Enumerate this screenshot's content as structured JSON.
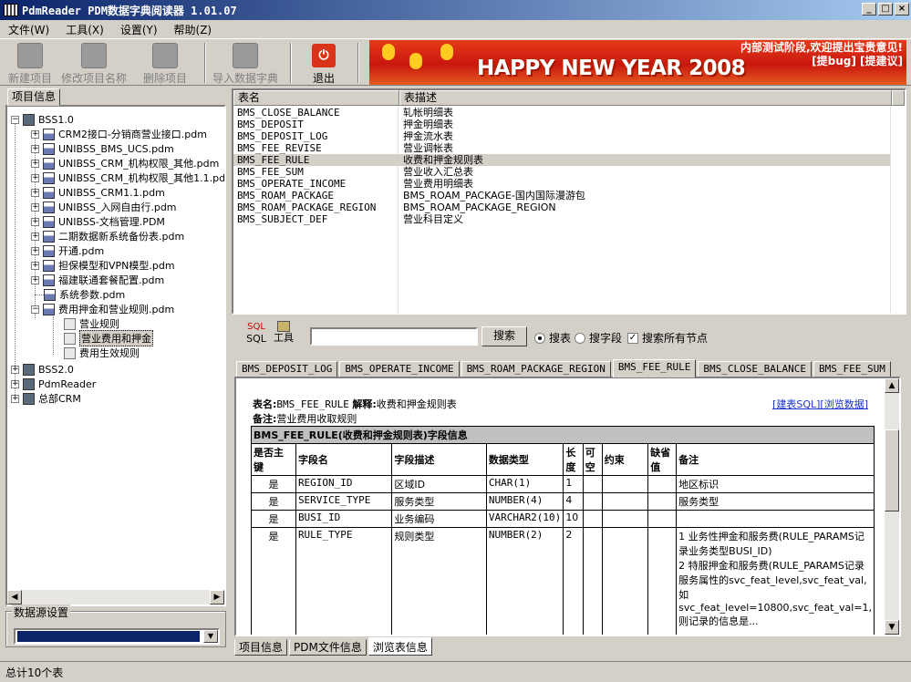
{
  "window": {
    "title": "PdmReader PDM数据字典阅读器 1.01.07",
    "controls": [
      "_",
      "□",
      "×"
    ]
  },
  "menu": [
    "文件(W)",
    "工具(X)",
    "设置(Y)",
    "帮助(Z)"
  ],
  "toolbar": {
    "new_project": "新建项目",
    "rename_project": "修改项目名称",
    "delete_project": "删除项目",
    "import_pdm": "导入数据字典",
    "exit": "退出"
  },
  "banner": {
    "headline": "HAPPY NEW YEAR 2008",
    "notice_line1": "内部测试阶段,欢迎提出宝贵意见!",
    "notice_line2": "[提bug] [提建议]"
  },
  "left_panel": {
    "tab": "项目信息",
    "tree": {
      "roots": [
        "BSS1.0",
        "BSS2.0",
        "PdmReader",
        "总部CRM"
      ],
      "bss1_children": [
        "CRM2接口-分销商营业接口.pdm",
        "UNIBSS_BMS_UCS.pdm",
        "UNIBSS_CRM_机构权限_其他.pdm",
        "UNIBSS_CRM_机构权限_其他1.1.pdm",
        "UNIBSS_CRM1.1.pdm",
        "UNIBSS_入网自由行.pdm",
        "UNIBSS-文档管理.PDM",
        "二期数据新系统备份表.pdm",
        "开通.pdm",
        "担保模型和VPN模型.pdm",
        "福建联通套餐配置.pdm",
        "系统参数.pdm",
        "费用押金和营业规则.pdm"
      ],
      "fee_children": [
        "营业规则",
        "营业费用和押金",
        "费用生效规则"
      ]
    },
    "datasource_label": "数据源设置"
  },
  "table_list": {
    "columns": [
      "表名",
      "表描述"
    ],
    "rows": [
      [
        "BMS_CLOSE_BALANCE",
        "轧帐明细表"
      ],
      [
        "BMS_DEPOSIT",
        "押金明细表"
      ],
      [
        "BMS_DEPOSIT_LOG",
        "押金流水表"
      ],
      [
        "BMS_FEE_REVISE",
        "营业调帐表"
      ],
      [
        "BMS_FEE_RULE",
        "收费和押金规则表"
      ],
      [
        "BMS_FEE_SUM",
        "营业收入汇总表"
      ],
      [
        "BMS_OPERATE_INCOME",
        "营业费用明细表"
      ],
      [
        "BMS_ROAM_PACKAGE",
        "BMS_ROAM_PACKAGE-国内国际漫游包"
      ],
      [
        "BMS_ROAM_PACKAGE_REGION",
        "BMS_ROAM_PACKAGE_REGION"
      ],
      [
        "BMS_SUBJECT_DEF",
        "营业科目定义"
      ]
    ]
  },
  "search": {
    "sql_label": "SQL",
    "tools_label": "工具",
    "sql_icon_text": "SQL",
    "input_value": "",
    "button": "搜索",
    "radio_table": "搜表",
    "radio_field": "搜字段",
    "checkbox_all": "搜索所有节点"
  },
  "detail_tabs": [
    "BMS_DEPOSIT_LOG",
    "BMS_OPERATE_INCOME",
    "BMS_ROAM_PACKAGE_REGION",
    "BMS_FEE_RULE",
    "BMS_CLOSE_BALANCE",
    "BMS_FEE_SUM"
  ],
  "detail": {
    "table_label": "表名:",
    "table_name": "BMS_FEE_RULE",
    "explain_label": "解释:",
    "explain": "收费和押金规则表",
    "remark_label": "备注:",
    "remark": "营业费用收取规则",
    "link_sql": "[建表SQL]",
    "link_data": "[浏览数据]",
    "caption": "BMS_FEE_RULE(收费和押金规则表)字段信息",
    "headers": [
      "是否主键",
      "字段名",
      "字段描述",
      "数据类型",
      "长度",
      "可空",
      "约束",
      "缺省值",
      "备注"
    ],
    "rows": [
      {
        "pk": "是",
        "name": "REGION_ID",
        "desc": "区域ID",
        "type": "CHAR(1)",
        "len": "1",
        "nullable": "",
        "constraint": "",
        "default": "",
        "remark": "地区标识"
      },
      {
        "pk": "是",
        "name": "SERVICE_TYPE",
        "desc": "服务类型",
        "type": "NUMBER(4)",
        "len": "4",
        "nullable": "",
        "constraint": "",
        "default": "",
        "remark": "服务类型"
      },
      {
        "pk": "是",
        "name": "BUSI_ID",
        "desc": "业务编码",
        "type": "VARCHAR2(10)",
        "len": "10",
        "nullable": "",
        "constraint": "",
        "default": "",
        "remark": ""
      },
      {
        "pk": "是",
        "name": "RULE_TYPE",
        "desc": "规则类型",
        "type": "NUMBER(2)",
        "len": "2",
        "nullable": "",
        "constraint": "",
        "default": "",
        "remark": "1 业务性押金和服务费(RULE_PARAMS记录业务类型BUSI_ID)\n2 特服押金和服务费(RULE_PARAMS记录服务属性的svc_feat_level,svc_feat_val,如svc_feat_level=10800,svc_feat_val=1,则记录的信息是..."
      }
    ]
  },
  "bottom_tabs": [
    "项目信息",
    "PDM文件信息",
    "浏览表信息"
  ],
  "status": "总计10个表"
}
